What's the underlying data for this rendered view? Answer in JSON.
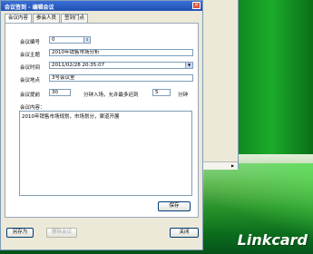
{
  "window": {
    "title": "会议签到 - 编辑会议",
    "close_glyph": "×"
  },
  "tabs": [
    {
      "label": "会议内容"
    },
    {
      "label": "参会人员"
    },
    {
      "label": "签到门点"
    }
  ],
  "form": {
    "number_label": "会议编号",
    "number_value": "0",
    "subject_label": "会议主题",
    "subject_value": "2010年销售市场分析",
    "time_label": "会议时间",
    "time_value": "2011/02/28 20:35:07",
    "location_label": "会议地点",
    "location_value": "3号会议室",
    "remind_label": "会议提前",
    "remind_value": "30",
    "remind_mid_text": "分钟入场，允许最多迟到",
    "late_value": "5",
    "late_unit": "分钟",
    "content_label": "会议内容：",
    "content_value": "2010年销售市场规划，市场划分，渠道开展",
    "save_label": "保存"
  },
  "footer": {
    "save_as_label": "另存为",
    "delete_label": "删除会议",
    "close_label": "关闭"
  },
  "background": {
    "logo_text": "Linkcard"
  },
  "icons": {
    "spin": "spinner-icon",
    "dropdown": "chevron-down-icon",
    "scroll": "arrow-right-icon"
  }
}
